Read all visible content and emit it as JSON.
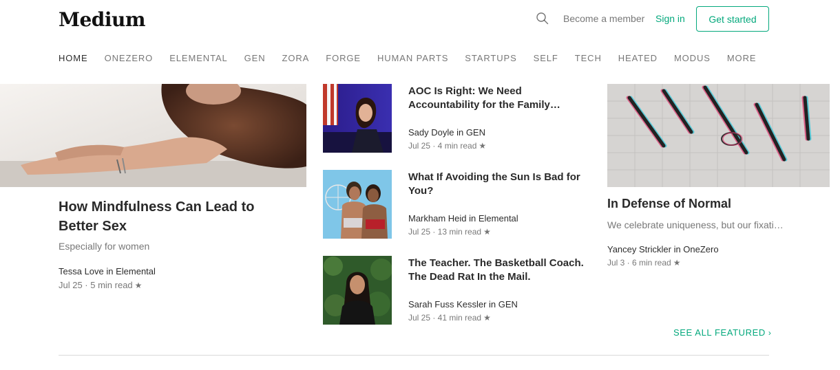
{
  "header": {
    "logo": "Medium",
    "become_member": "Become a member",
    "sign_in": "Sign in",
    "get_started": "Get started",
    "accent_color": "#03a87c"
  },
  "nav": {
    "items": [
      "HOME",
      "ONEZERO",
      "ELEMENTAL",
      "GEN",
      "ZORA",
      "FORGE",
      "HUMAN PARTS",
      "STARTUPS",
      "SELF",
      "TECH",
      "HEATED",
      "MODUS",
      "MORE"
    ],
    "active": "HOME"
  },
  "featured": {
    "big": {
      "title": "How Mindfulness Can Lead to Better Sex",
      "subtitle": "Especially for women",
      "author": "Tessa Love in Elemental",
      "meta": "Jul 25 · 5 min read"
    },
    "list": [
      {
        "title": "AOC Is Right: We Need Accountability for the Family…",
        "author": "Sady Doyle in GEN",
        "meta": "Jul 25 · 4 min read"
      },
      {
        "title": "What If Avoiding the Sun Is Bad for You?",
        "author": "Markham Heid in Elemental",
        "meta": "Jul 25 · 13 min read"
      },
      {
        "title": "The Teacher. The Basketball Coach. The Dead Rat In the Mail.",
        "author": "Sarah Fuss Kessler in GEN",
        "meta": "Jul 25 · 41 min read"
      }
    ],
    "right": {
      "title": "In Defense of Normal",
      "subtitle": "We celebrate uniqueness, but our fixati…",
      "author": "Yancey Strickler in OneZero",
      "meta": "Jul 3 · 6 min read"
    },
    "see_all": "SEE ALL FEATURED",
    "star": "★"
  }
}
